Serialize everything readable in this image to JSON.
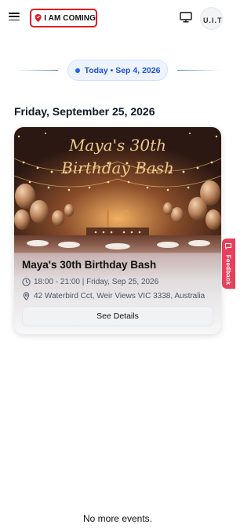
{
  "header": {
    "logo_text": "I AM COMING",
    "menu_icon": "hamburger-menu-icon",
    "monitor_icon": "monitor-icon",
    "avatar_text": "U.I.T"
  },
  "today_pill": {
    "label": "Today • Sep 4, 2026"
  },
  "date_heading": "Friday, September 25, 2026",
  "event": {
    "image_title_line1": "Maya's 30th",
    "image_title_line2": "Birthday Bash",
    "title": "Maya's 30th Birthday Bash",
    "time": "18:00 - 21:00 | Friday, Sep 25, 2026",
    "location": "42 Waterbird Cct, Weir Views VIC 3338, Australia",
    "details_button": "See Details"
  },
  "feedback": {
    "label": "Feedback"
  },
  "footer": {
    "no_more": "No more events."
  },
  "colors": {
    "brand_red": "#e01b24",
    "accent_blue": "#2563eb",
    "feedback_pink": "#e83f5b"
  }
}
